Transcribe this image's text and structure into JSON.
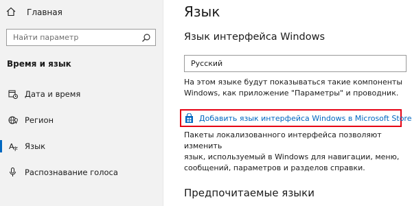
{
  "sidebar": {
    "home_label": "Главная",
    "search_placeholder": "Найти параметр",
    "section_title": "Время и язык",
    "items": [
      {
        "label": "Дата и время",
        "icon": "calendar-clock-icon"
      },
      {
        "label": "Регион",
        "icon": "globe-pin-icon"
      },
      {
        "label": "Язык",
        "icon": "language-icon",
        "selected": true
      },
      {
        "label": "Распознавание голоса",
        "icon": "microphone-icon"
      }
    ]
  },
  "main": {
    "title": "Язык",
    "interface_title": "Язык интерфейса Windows",
    "selected_language": "Русский",
    "description_line1": "На этом языке будут показываться такие компоненты",
    "description_line2": "Windows, как приложение \"Параметры\" и проводник.",
    "store_link_label": "Добавить язык интерфейса Windows в Microsoft Store",
    "store_desc_line1": "Пакеты локализованного интерфейса позволяют изменить",
    "store_desc_line2": "язык, используемый в Windows для навигации, меню,",
    "store_desc_line3": "сообщений, параметров и разделов справки.",
    "preferred_title": "Предпочитаемые языки"
  },
  "colors": {
    "accent": "#0067c0",
    "highlight_border": "#e60012",
    "sidebar_bg": "#f2f2f2"
  }
}
